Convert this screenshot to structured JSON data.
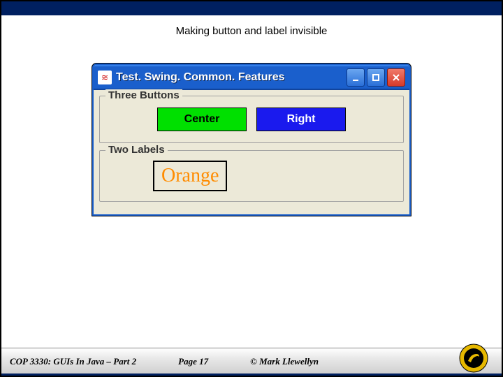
{
  "caption": "Making button and label invisible",
  "window": {
    "title": "Test. Swing. Common. Features",
    "java_icon_glyph": "≋",
    "buttons": {
      "minimize": "minimize",
      "maximize": "maximize",
      "close": "close"
    }
  },
  "panels": {
    "three_buttons": {
      "legend": "Three Buttons",
      "center_label": "Center",
      "right_label": "Right"
    },
    "two_labels": {
      "legend": "Two Labels",
      "orange_text": "Orange"
    }
  },
  "footer": {
    "course": "COP 3330:  GUIs In Java – Part 2",
    "page": "Page 17",
    "copyright": "© Mark Llewellyn"
  }
}
